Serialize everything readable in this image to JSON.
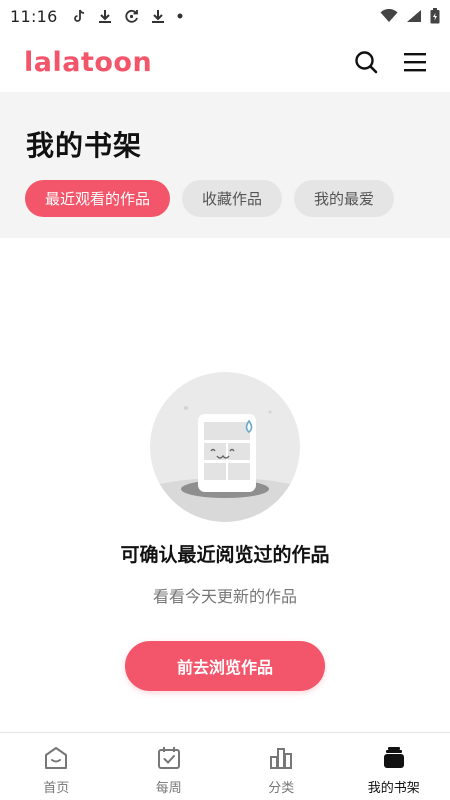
{
  "status_bar": {
    "time": "11:16",
    "left_icons": [
      "tiktok-icon",
      "download-icon",
      "sync-icon",
      "download-icon",
      "dot-icon"
    ],
    "right_icons": [
      "wifi-icon",
      "signal-icon",
      "battery-icon"
    ]
  },
  "header": {
    "logo_text": "lalatoon",
    "brand_color": "#f3566a",
    "icons": [
      "search-icon",
      "menu-icon"
    ]
  },
  "shelf": {
    "title": "我的书架",
    "tabs": [
      {
        "label": "最近观看的作品",
        "active": true
      },
      {
        "label": "收藏作品",
        "active": false
      },
      {
        "label": "我的最爱",
        "active": false
      }
    ]
  },
  "empty_state": {
    "illustration": "empty-book-icon",
    "title": "可确认最近阅览过的作品",
    "subtitle": "看看今天更新的作品",
    "cta_label": "前去浏览作品"
  },
  "bottom_nav": {
    "items": [
      {
        "label": "首页",
        "icon": "home-icon",
        "active": false
      },
      {
        "label": "每周",
        "icon": "calendar-check-icon",
        "active": false
      },
      {
        "label": "分类",
        "icon": "category-icon",
        "active": false
      },
      {
        "label": "我的书架",
        "icon": "bookshelf-icon",
        "active": true
      }
    ]
  }
}
